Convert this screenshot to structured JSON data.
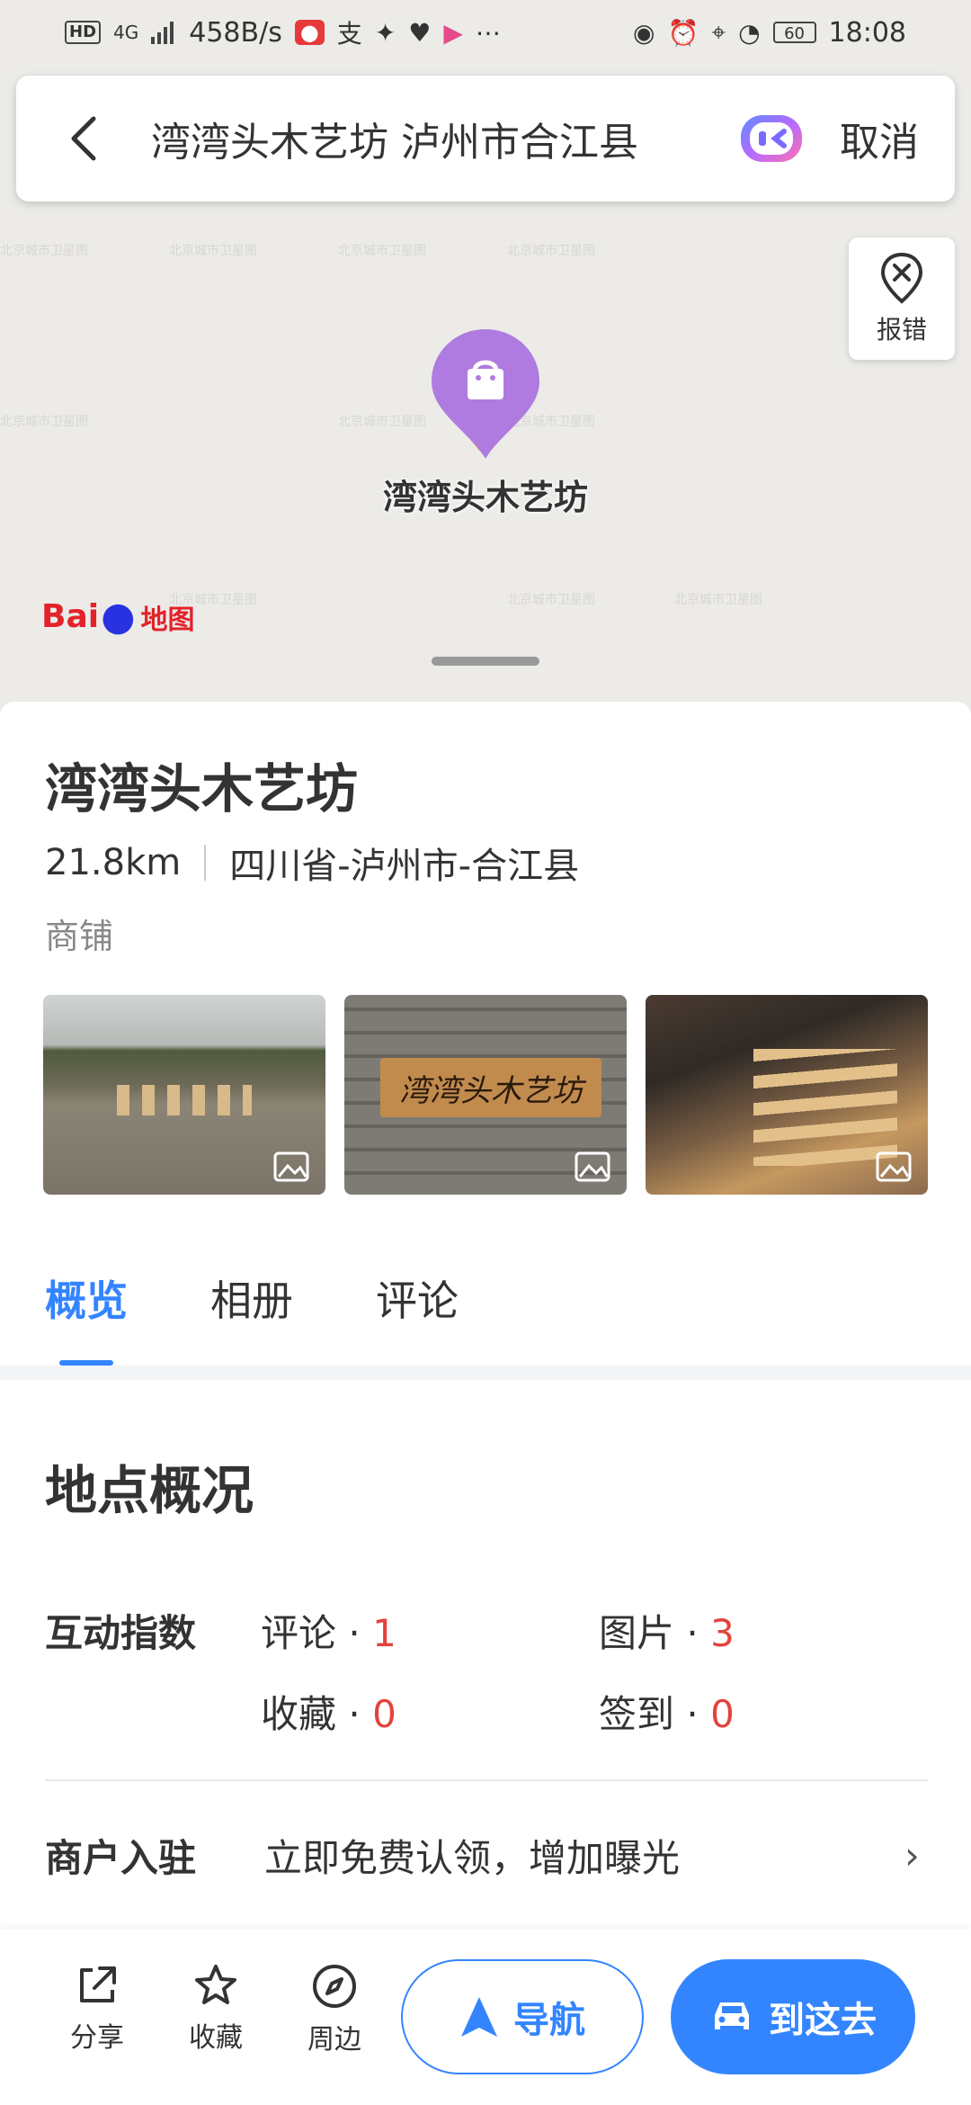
{
  "status_bar": {
    "network_badge": "HD",
    "signal": "4G",
    "speed": "458B/s",
    "battery": "60",
    "time": "18:08"
  },
  "search": {
    "query": "湾湾头木艺坊 泸州市合江县",
    "cancel_label": "取消"
  },
  "map": {
    "report_label": "报错",
    "pin_label": "湾湾头木艺坊",
    "logo": "Baidu地图"
  },
  "poi": {
    "title": "湾湾头木艺坊",
    "distance": "21.8km",
    "address": "四川省-泸州市-合江县",
    "category": "商铺",
    "photos": [
      {
        "alt": "photo-yard-stools"
      },
      {
        "alt": "photo-sign",
        "sign_text": "湾湾头木艺坊"
      },
      {
        "alt": "photo-workshop"
      }
    ]
  },
  "tabs": [
    {
      "label": "概览",
      "active": true
    },
    {
      "label": "相册",
      "active": false
    },
    {
      "label": "评论",
      "active": false
    }
  ],
  "overview": {
    "section_title": "地点概况",
    "stats_label": "互动指数",
    "stats": [
      {
        "label": "评论 · ",
        "value": "1"
      },
      {
        "label": "图片 · ",
        "value": "3"
      },
      {
        "label": "收藏 · ",
        "value": "0"
      },
      {
        "label": "签到 · ",
        "value": "0"
      }
    ],
    "merchant_label": "商户入驻",
    "merchant_text": "立即免费认领，增加曝光"
  },
  "bottom_bar": {
    "share": "分享",
    "favorite": "收藏",
    "nearby": "周边",
    "navigate": "导航",
    "go_there": "到这去"
  },
  "colors": {
    "accent": "#3385ff",
    "pin": "#b07be0",
    "stat_number": "#e3433d"
  }
}
